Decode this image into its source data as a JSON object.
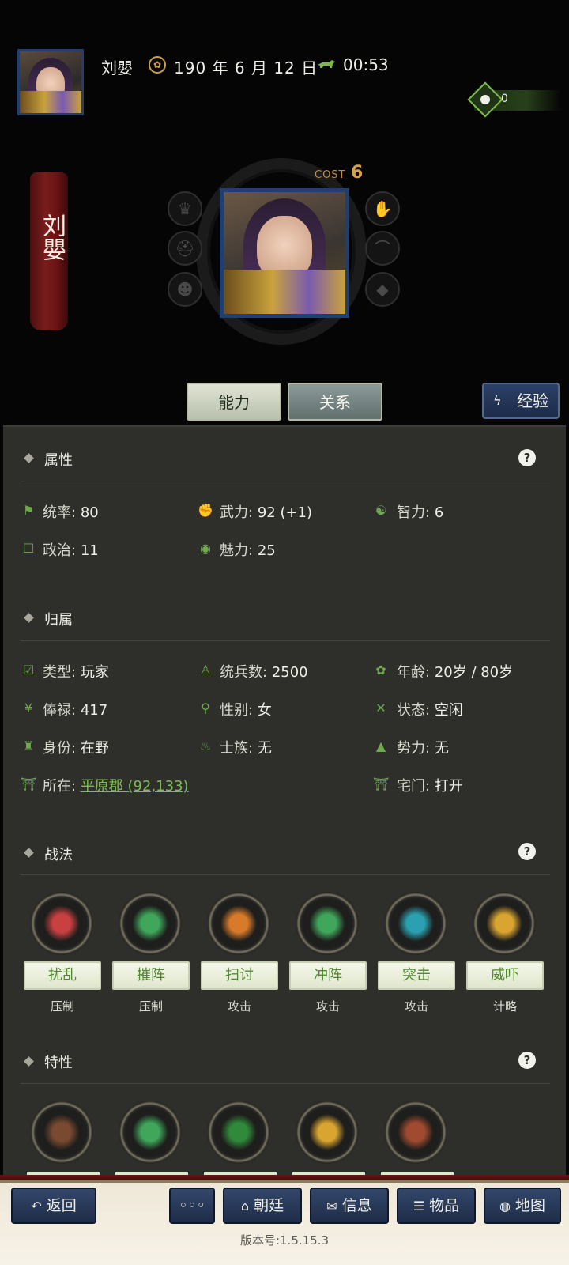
{
  "header": {
    "name": "刘嬰",
    "date": "190 年 6 月 12 日",
    "time": "00:53",
    "resource_value": "0"
  },
  "banner": {
    "name": "刘嬰"
  },
  "portrait": {
    "cost_label": "COST",
    "cost_value": "6"
  },
  "tabs": {
    "ability": "能力",
    "relation": "关系",
    "exp": "经验"
  },
  "attributes": {
    "title": "属性",
    "items": [
      {
        "label": "统率:",
        "value": "80",
        "icon": "flag-icon"
      },
      {
        "label": "武力:",
        "value": "92 (+1)",
        "icon": "arm-icon"
      },
      {
        "label": "智力:",
        "value": "6",
        "icon": "brain-icon"
      },
      {
        "label": "政治:",
        "value": "11",
        "icon": "scroll-icon"
      },
      {
        "label": "魅力:",
        "value": "25",
        "icon": "eye-icon"
      }
    ]
  },
  "affiliation": {
    "title": "归属",
    "items": [
      {
        "label": "类型:",
        "value": "玩家"
      },
      {
        "label": "统兵数:",
        "value": "2500"
      },
      {
        "label": "年龄:",
        "value": "20岁 / 80岁"
      },
      {
        "label": "俸禄:",
        "value": "417"
      },
      {
        "label": "性别:",
        "value": "女"
      },
      {
        "label": "状态:",
        "value": "空闲"
      },
      {
        "label": "身份:",
        "value": "在野"
      },
      {
        "label": "士族:",
        "value": "无"
      },
      {
        "label": "势力:",
        "value": "无"
      },
      {
        "label": "所在:",
        "value": "平原郡 (92,133)"
      },
      {
        "label": "宅门:",
        "value": "打开"
      }
    ]
  },
  "tactics": {
    "title": "战法",
    "items": [
      {
        "name": "扰乱",
        "type": "压制",
        "color": "#c84040"
      },
      {
        "name": "摧阵",
        "type": "压制",
        "color": "#3fa65a"
      },
      {
        "name": "扫讨",
        "type": "攻击",
        "color": "#d77a2a"
      },
      {
        "name": "冲阵",
        "type": "攻击",
        "color": "#3fa65a"
      },
      {
        "name": "突击",
        "type": "攻击",
        "color": "#2aa0b0"
      },
      {
        "name": "威吓",
        "type": "计略",
        "color": "#d9a530"
      }
    ]
  },
  "traits": {
    "title": "特性",
    "items": [
      {
        "color": "#7a4a30"
      },
      {
        "color": "#3fa65a"
      },
      {
        "color": "#2f8a3a"
      },
      {
        "color": "#d9a530"
      },
      {
        "color": "#a04a30"
      }
    ]
  },
  "bottom": {
    "back": "返回",
    "more": "◦◦◦",
    "court": "朝廷",
    "info": "信息",
    "items": "物品",
    "map": "地图",
    "version": "版本号:1.5.15.3"
  }
}
